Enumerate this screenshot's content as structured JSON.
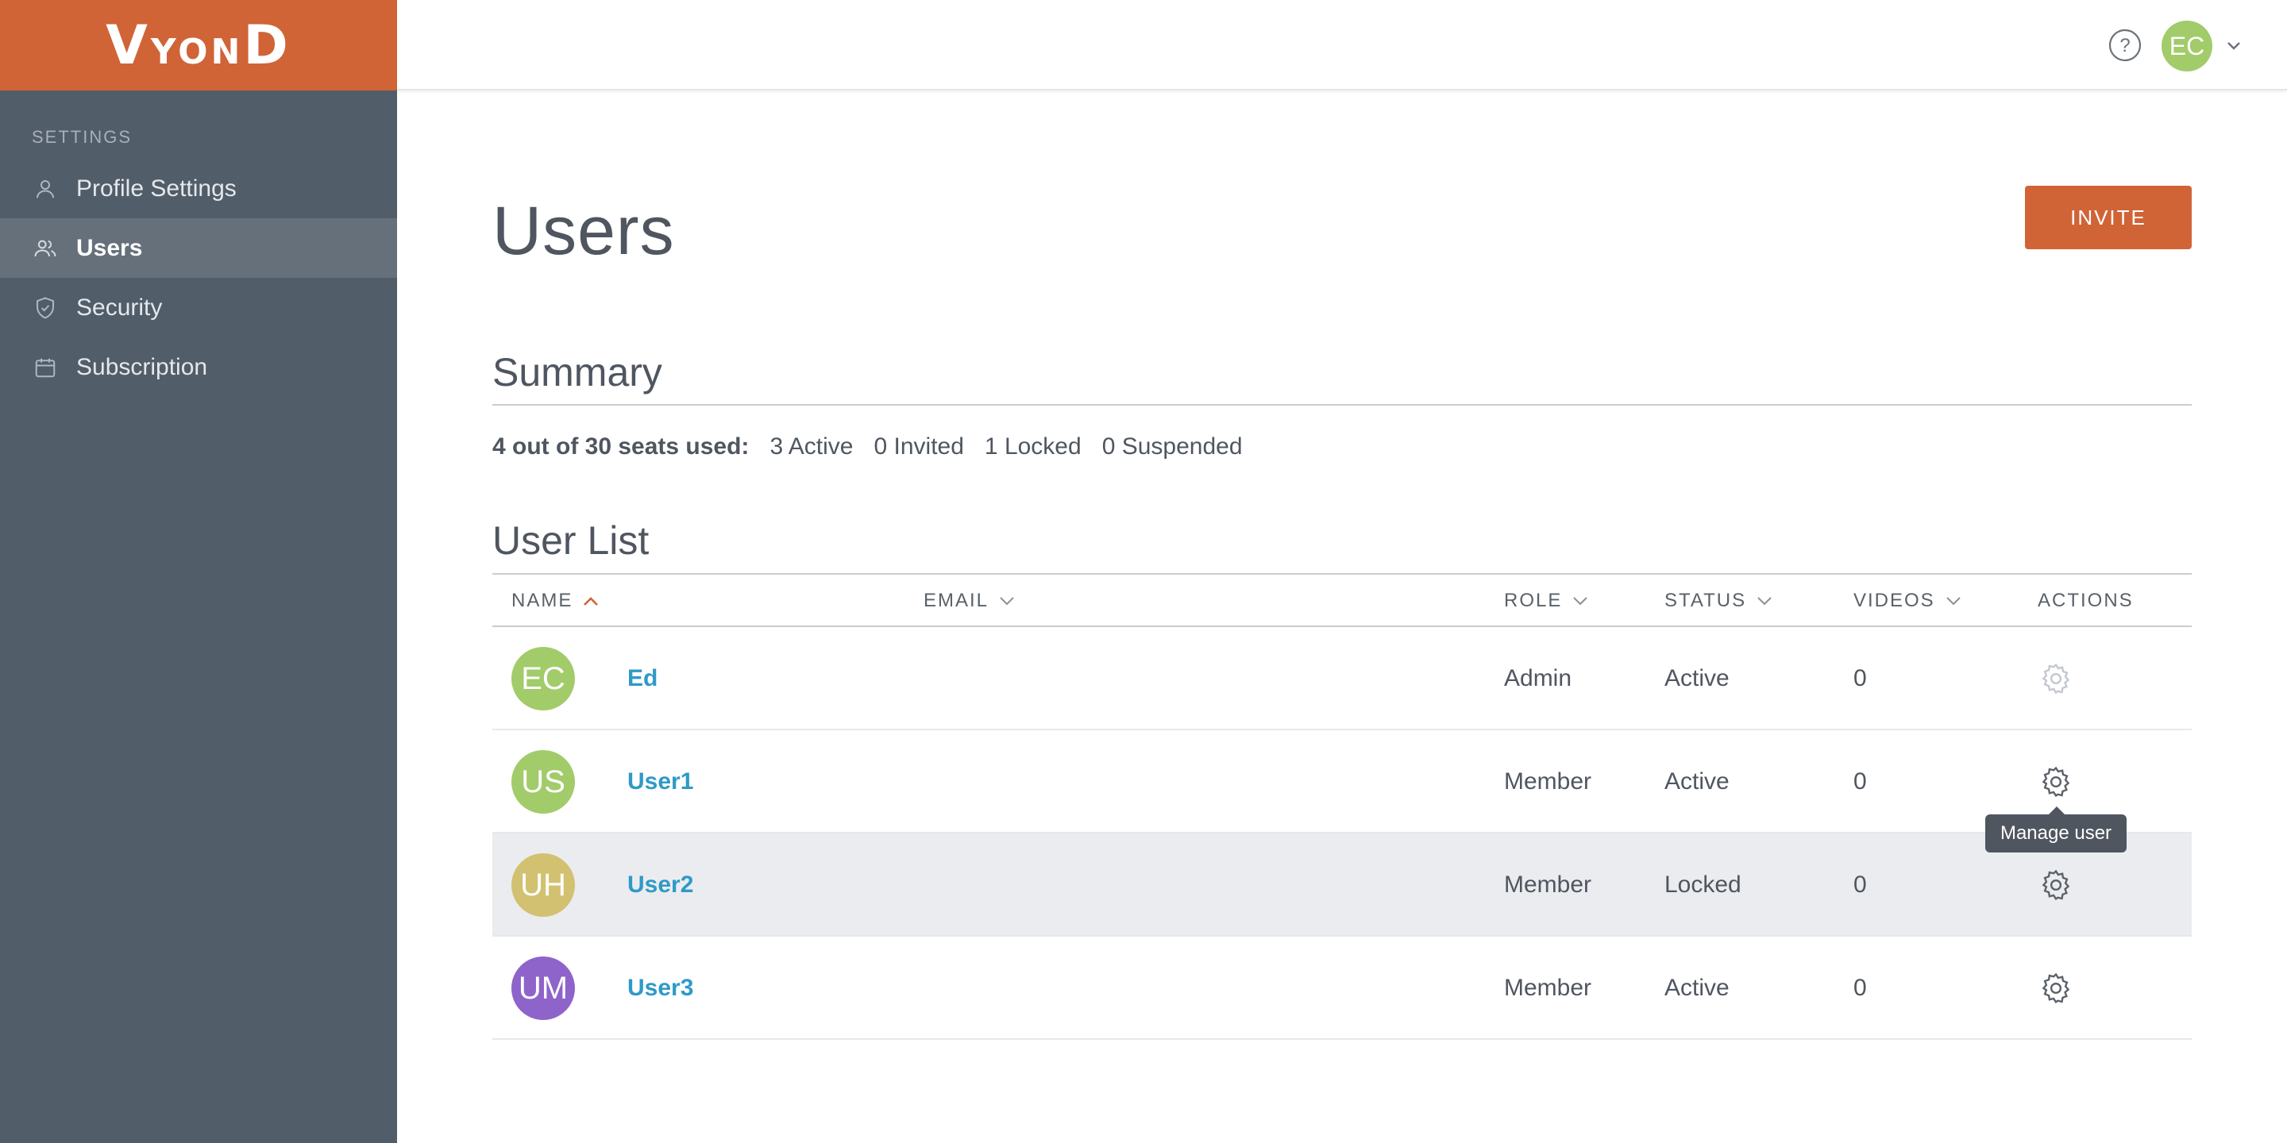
{
  "brand": {
    "logo_v": "V",
    "logo_yon": "YON",
    "logo_d": "D"
  },
  "sidebar": {
    "heading": "SETTINGS",
    "items": [
      {
        "label": "Profile Settings",
        "icon": "user-icon"
      },
      {
        "label": "Users",
        "icon": "users-icon",
        "active": true
      },
      {
        "label": "Security",
        "icon": "shield-icon"
      },
      {
        "label": "Subscription",
        "icon": "calendar-icon"
      }
    ]
  },
  "topbar": {
    "help_icon": "question-circle-icon",
    "avatar_initials": "EC",
    "avatar_color": "#a2cb6a"
  },
  "page": {
    "title": "Users",
    "invite_label": "INVITE"
  },
  "summary": {
    "title": "Summary",
    "lead": "4 out of 30 seats used:",
    "active": "3 Active",
    "invited": "0 Invited",
    "locked": "1 Locked",
    "suspended": "0 Suspended"
  },
  "user_list": {
    "title": "User List",
    "columns": {
      "name": "NAME",
      "email": "EMAIL",
      "role": "ROLE",
      "status": "STATUS",
      "videos": "VIDEOS",
      "actions": "ACTIONS"
    },
    "rows": [
      {
        "initials": "EC",
        "color": "#a2cb6a",
        "name": "Ed",
        "role": "Admin",
        "status": "Active",
        "videos": "0"
      },
      {
        "initials": "US",
        "color": "#a2cb6a",
        "name": "User1",
        "role": "Member",
        "status": "Active",
        "videos": "0"
      },
      {
        "initials": "UH",
        "color": "#d2c170",
        "name": "User2",
        "role": "Member",
        "status": "Locked",
        "videos": "0"
      },
      {
        "initials": "UM",
        "color": "#8e63ca",
        "name": "User3",
        "role": "Member",
        "status": "Active",
        "videos": "0"
      }
    ],
    "tooltip": "Manage user"
  },
  "colors": {
    "accent": "#d06436",
    "sidebar": "#515d69",
    "link": "#2e9ac8"
  }
}
